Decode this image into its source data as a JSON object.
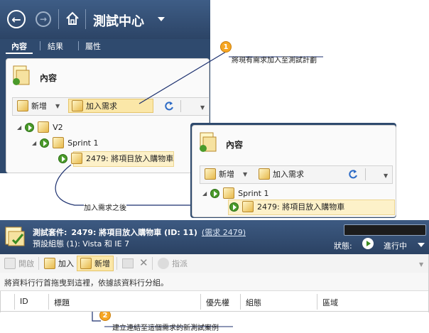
{
  "header": {
    "title": "測試中心",
    "tabs": [
      {
        "label": "內容"
      },
      {
        "label": "結果"
      },
      {
        "label": "屬性"
      }
    ]
  },
  "panel_before": {
    "title": "內容",
    "toolbar": {
      "new_label": "新增",
      "add_requirement_label": "加入需求"
    },
    "tree": [
      {
        "label": "V2"
      },
      {
        "label": "Sprint 1"
      },
      {
        "label": "2479: 將項目放入購物車"
      }
    ]
  },
  "panel_after": {
    "title": "內容",
    "toolbar": {
      "new_label": "新增",
      "add_requirement_label": "加入需求"
    },
    "tree": [
      {
        "label": "Sprint 1"
      },
      {
        "label": "2479: 將項目放入購物車"
      }
    ]
  },
  "callouts": {
    "one_number": "1",
    "one_text": "將現有需求加入至測試計劃",
    "after_text": "加入需求之後",
    "two_number": "2",
    "two_text": "建立連結至這個需求的新測試案例"
  },
  "suite": {
    "title_prefix": "測試套件:",
    "title": "2479: 將項目放入購物車 (ID: 11)",
    "link": "(需求 2479)",
    "default_config": "預設組態 (1): Vista 和 IE 7",
    "status_label": "狀態:",
    "status_value": "進行中",
    "toolbar": {
      "open_label": "開啟",
      "add_label": "加入",
      "new_label": "新增",
      "assign_label": "指派"
    },
    "group_hint": "將資料行行首拖曳到這裡，依據該資料行分組。",
    "columns": [
      "ID",
      "標題",
      "優先權",
      "組態",
      "區域"
    ]
  },
  "colors": {
    "header_bg": "#2f4a6e",
    "highlight": "#fbe7a8",
    "callout": "#f6a623"
  }
}
